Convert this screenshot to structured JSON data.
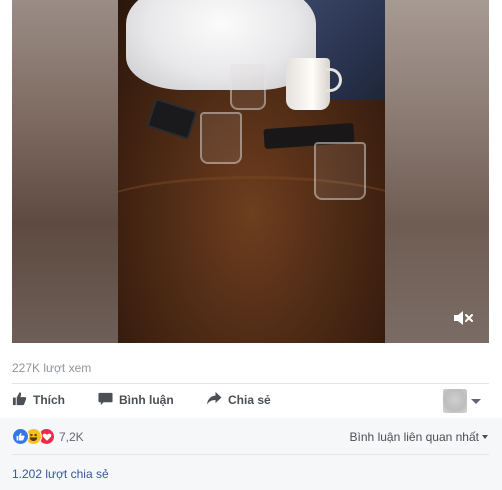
{
  "video": {
    "mute_icon": "speaker-muted-icon"
  },
  "stats": {
    "views": "227K lượt xem"
  },
  "actions": {
    "like_label": "Thích",
    "like_icon": "thumbs-up-icon",
    "comment_label": "Bình luận",
    "comment_icon": "speech-bubble-icon",
    "share_label": "Chia sẻ",
    "share_icon": "share-arrow-icon"
  },
  "reactions": {
    "icons": [
      "like-reaction-icon",
      "haha-reaction-icon",
      "love-reaction-icon"
    ],
    "count": "7,2K",
    "colors": {
      "like": "#3578e5",
      "haha": "#f7c31b",
      "love": "#f0284a"
    }
  },
  "comments": {
    "sort_label": "Bình luận liên quan nhất"
  },
  "shares": {
    "label": "1.202 lượt chia sẻ"
  },
  "colors": {
    "link": "#365899",
    "muted_text": "#90949c",
    "footer_bg": "#f6f7f9"
  }
}
